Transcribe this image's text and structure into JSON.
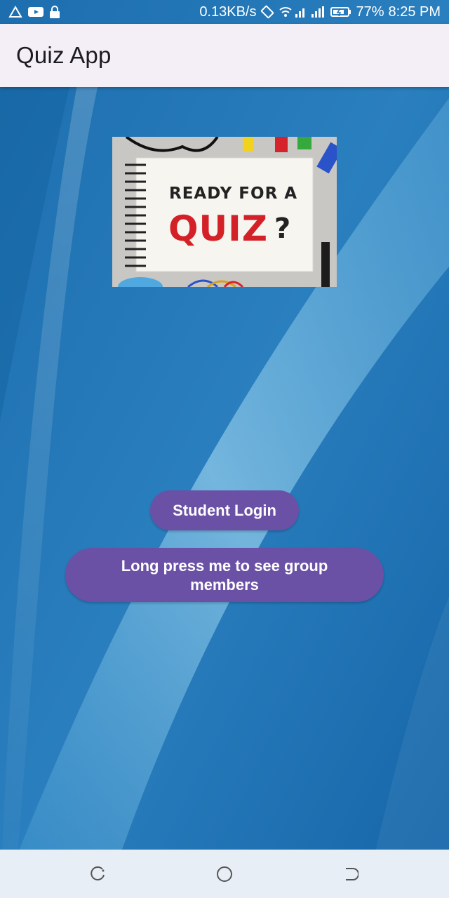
{
  "status_bar": {
    "network_speed": "0.13KB/s",
    "battery_percent": "77%",
    "time": "8:25 PM",
    "icons": [
      "warning-icon",
      "youtube-icon",
      "lock-icon",
      "rotate-icon",
      "wifi-icon",
      "signal-icon",
      "signal-icon",
      "battery-icon"
    ]
  },
  "app_bar": {
    "title": "Quiz App"
  },
  "hero_image": {
    "line1": "READY FOR A",
    "line2": "QUIZ",
    "question_mark": "?"
  },
  "buttons": {
    "student_login": "Student Login",
    "group_members": "Long press me to see group members"
  },
  "nav_bar": {
    "icons": [
      "recent-apps-icon",
      "home-icon",
      "back-icon"
    ]
  },
  "colors": {
    "button": "#6a51a6",
    "app_bar": "#f4eef7",
    "wallpaper": "#1a6fb0"
  }
}
